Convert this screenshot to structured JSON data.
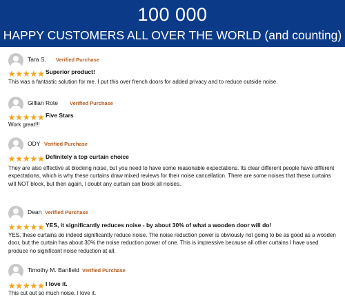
{
  "banner": {
    "count": "100 000",
    "tagline": "HAPPY CUSTOMERS ALL OVER THE WORLD (and counting)",
    "background_color": "#0b3a88"
  },
  "verified_label": "Verified Purchase",
  "star_color": "#f4a41c",
  "reviews": [
    {
      "name": "Tara S.",
      "rating": 5,
      "title": "Superior product!",
      "body": "This was a fantastic solution for me. I put this over french doors for added privacy and to reduce outside noise."
    },
    {
      "name": "Gillian Rote",
      "rating": 5,
      "title": "Five Stars",
      "body": "Work great!!!"
    },
    {
      "name": "ODY",
      "rating": 5,
      "title": "Definitely a top curtain choice",
      "body": "They are also effective at blocking noise, but you need to have some reasonable expectations. Its clear different people have different expectations, which is why these curtains draw mixed reviews for their noise cancellation. There are some noises that these curtains will NOT block, but then again, I doubt any curtain can block all noises."
    },
    {
      "name": "Dean",
      "rating": 5,
      "title": "YES, it significantly reduces noise - by about 30% of what a wooden door will do!",
      "body": "YES, these curtains do indeed significantly reduce noise. The noise reduction power is obviously not going to be as good as a wooden door, but the curtain has about 30% the noise reduction power of one. This is impressive because all other curtains I have used produce no significant noise reduction at all."
    },
    {
      "name": "Timothy M. Banfield",
      "rating": 5,
      "title": "I love it.",
      "body": "This cut out so much noise. I love it."
    }
  ]
}
